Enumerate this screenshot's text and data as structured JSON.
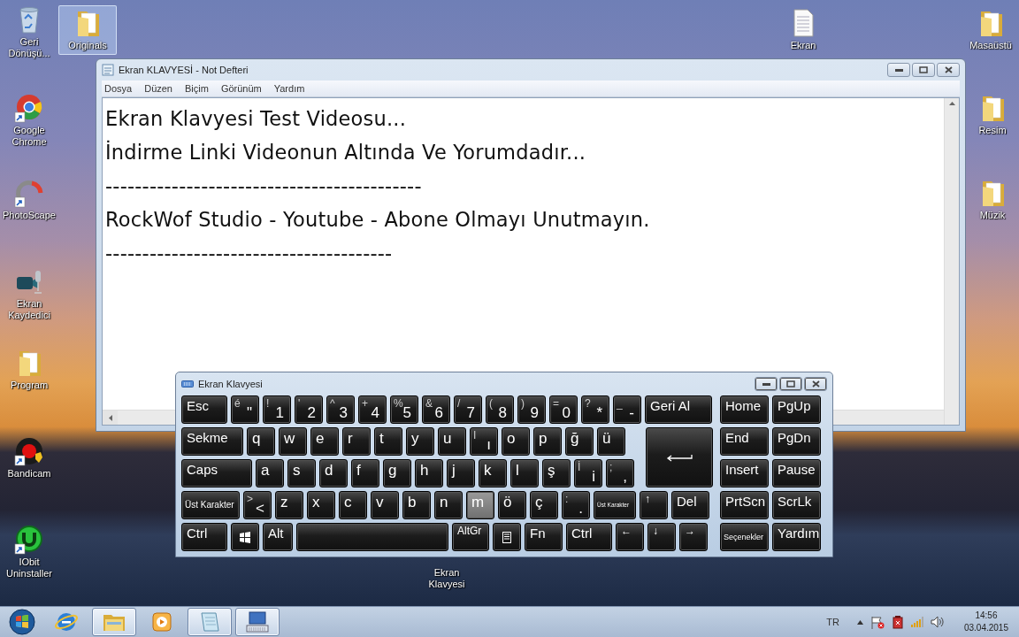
{
  "desktop": {
    "icons": [
      {
        "label": "Geri Dönüşü...",
        "kind": "bin",
        "selected": false
      },
      {
        "label": "Originals",
        "kind": "folder",
        "selected": true
      },
      {
        "label": "Google Chrome",
        "kind": "chrome",
        "selected": false
      },
      {
        "label": "PhotoScape",
        "kind": "gauge",
        "selected": false
      },
      {
        "label": "Ekran Kaydedici",
        "kind": "recorder",
        "selected": false
      },
      {
        "label": "Program",
        "kind": "folder",
        "selected": false
      },
      {
        "label": "Bandicam",
        "kind": "reddot",
        "selected": false
      },
      {
        "label": "IObit Uninstaller",
        "kind": "greenring",
        "selected": false
      },
      {
        "label": "Ekran",
        "kind": "textfile",
        "selected": false
      },
      {
        "label": "Masaüstü",
        "kind": "folder",
        "selected": false
      },
      {
        "label": "Resim",
        "kind": "folder",
        "selected": false
      },
      {
        "label": "Müzik",
        "kind": "folder",
        "selected": false
      },
      {
        "label": "Ekran Klavyesi",
        "kind": "covered",
        "selected": false
      }
    ]
  },
  "notepad": {
    "title": "Ekran KLAVYESİ - Not Defteri",
    "menu": [
      "Dosya",
      "Düzen",
      "Biçim",
      "Görünüm",
      "Yardım"
    ],
    "lines": [
      "Ekran Klavyesi Test Videosu...",
      "İndirme Linki Videonun Altında Ve Yorumdadır...",
      "-------------------------------------------",
      "RockWof Studio - Youtube - Abone Olmayı Unutmayın.",
      "---------------------------------------"
    ]
  },
  "keyboard": {
    "title": "Ekran Klavyesi",
    "rows": [
      {
        "keys": [
          {
            "label": "Esc",
            "kind": "esc",
            "lit": false
          },
          {
            "shift_label": "é",
            "label": "\"",
            "kind": "char",
            "lit": false
          },
          {
            "shift_label": "!",
            "label": "1",
            "kind": "char",
            "lit": false
          },
          {
            "shift_label": "'",
            "label": "2",
            "kind": "char",
            "lit": false
          },
          {
            "shift_label": "^",
            "label": "3",
            "kind": "char",
            "lit": false
          },
          {
            "shift_label": "+",
            "label": "4",
            "kind": "char",
            "lit": false
          },
          {
            "shift_label": "%",
            "label": "5",
            "kind": "char",
            "lit": false
          },
          {
            "shift_label": "&",
            "label": "6",
            "kind": "char",
            "lit": false
          },
          {
            "shift_label": "/",
            "label": "7",
            "kind": "char",
            "lit": false
          },
          {
            "shift_label": "(",
            "label": "8",
            "kind": "char",
            "lit": false
          },
          {
            "shift_label": ")",
            "label": "9",
            "kind": "char",
            "lit": false
          },
          {
            "shift_label": "=",
            "label": "0",
            "kind": "char",
            "lit": false
          },
          {
            "shift_label": "?",
            "label": "*",
            "kind": "char",
            "lit": false
          },
          {
            "shift_label": "_",
            "label": "-",
            "kind": "char",
            "lit": false
          },
          {
            "label": "Geri Al",
            "kind": "back",
            "lit": false
          }
        ]
      },
      {
        "keys": [
          {
            "label": "Sekme",
            "kind": "tab",
            "lit": false
          },
          {
            "label": "q",
            "kind": "char",
            "lit": false
          },
          {
            "label": "w",
            "kind": "char",
            "lit": false
          },
          {
            "label": "e",
            "kind": "char",
            "lit": false
          },
          {
            "label": "r",
            "kind": "char",
            "lit": false
          },
          {
            "label": "t",
            "kind": "char",
            "lit": false
          },
          {
            "label": "y",
            "kind": "char",
            "lit": false
          },
          {
            "label": "u",
            "kind": "char",
            "lit": false
          },
          {
            "shift_label": "I",
            "label": "ı",
            "kind": "char",
            "lit": false
          },
          {
            "label": "o",
            "kind": "char",
            "lit": false
          },
          {
            "label": "p",
            "kind": "char",
            "lit": false
          },
          {
            "label": "ğ",
            "kind": "char",
            "lit": false
          },
          {
            "label": "ü",
            "kind": "char",
            "lit": false
          },
          {
            "kind": "enter",
            "lit": false
          }
        ]
      },
      {
        "keys": [
          {
            "label": "Caps",
            "kind": "caps",
            "lit": false
          },
          {
            "label": "a",
            "kind": "char",
            "lit": false
          },
          {
            "label": "s",
            "kind": "char",
            "lit": false
          },
          {
            "label": "d",
            "kind": "char",
            "lit": false
          },
          {
            "label": "f",
            "kind": "char",
            "lit": false
          },
          {
            "label": "g",
            "kind": "char",
            "lit": false
          },
          {
            "label": "h",
            "kind": "char",
            "lit": false
          },
          {
            "label": "j",
            "kind": "char",
            "lit": false
          },
          {
            "label": "k",
            "kind": "char",
            "lit": false
          },
          {
            "label": "l",
            "kind": "char",
            "lit": false
          },
          {
            "label": "ş",
            "kind": "char",
            "lit": false
          },
          {
            "shift_label": "İ",
            "label": "i",
            "kind": "char",
            "lit": false
          },
          {
            "shift_label": ";",
            "label": ",",
            "kind": "char",
            "lit": false
          }
        ]
      },
      {
        "keys": [
          {
            "label": "Üst Karakter",
            "kind": "lshift",
            "lit": false
          },
          {
            "shift_label": ">",
            "label": "<",
            "kind": "char",
            "lit": false
          },
          {
            "label": "z",
            "kind": "char",
            "lit": false
          },
          {
            "label": "x",
            "kind": "char",
            "lit": false
          },
          {
            "label": "c",
            "kind": "char",
            "lit": false
          },
          {
            "label": "v",
            "kind": "char",
            "lit": false
          },
          {
            "label": "b",
            "kind": "char",
            "lit": false
          },
          {
            "label": "n",
            "kind": "char",
            "lit": false
          },
          {
            "label": "m",
            "kind": "char",
            "lit": true
          },
          {
            "label": "ö",
            "kind": "char",
            "lit": false
          },
          {
            "label": "ç",
            "kind": "char",
            "lit": false
          },
          {
            "shift_label": ":",
            "label": ".",
            "kind": "char",
            "lit": false
          },
          {
            "label": "Üst Karakter",
            "kind": "rshift",
            "lit": false
          },
          {
            "label": "↑",
            "kind": "arrow",
            "lit": false
          },
          {
            "label": "Del",
            "kind": "del",
            "lit": false
          }
        ]
      },
      {
        "keys": [
          {
            "label": "Ctrl",
            "kind": "esc",
            "lit": false
          },
          {
            "kind": "win",
            "lit": false
          },
          {
            "label": "Alt",
            "kind": "alt",
            "lit": false
          },
          {
            "kind": "space",
            "lit": false
          },
          {
            "label": "AltGr",
            "kind": "altgr",
            "lit": false
          },
          {
            "kind": "menu",
            "lit": false
          },
          {
            "label": "Fn",
            "kind": "fn",
            "lit": false
          },
          {
            "label": "Ctrl",
            "kind": "esc",
            "lit": false
          },
          {
            "label": "←",
            "kind": "arrow",
            "lit": false
          },
          {
            "label": "↓",
            "kind": "arrow",
            "lit": false
          },
          {
            "label": "→",
            "kind": "arrow",
            "lit": false
          }
        ]
      }
    ],
    "side_rows": [
      {
        "keys": [
          {
            "label": "Home",
            "kind": "side",
            "lit": false
          },
          {
            "label": "PgUp",
            "kind": "side",
            "lit": false
          }
        ]
      },
      {
        "keys": [
          {
            "label": "End",
            "kind": "side",
            "lit": false
          },
          {
            "label": "PgDn",
            "kind": "side",
            "lit": false
          }
        ]
      },
      {
        "keys": [
          {
            "label": "Insert",
            "kind": "side",
            "lit": false
          },
          {
            "label": "Pause",
            "kind": "side",
            "lit": false
          }
        ]
      },
      {
        "keys": [
          {
            "label": "PrtScn",
            "kind": "side",
            "lit": false
          },
          {
            "label": "ScrLk",
            "kind": "side",
            "lit": false
          }
        ]
      },
      {
        "keys": [
          {
            "label": "Seçenekler",
            "kind": "opts",
            "lit": false
          },
          {
            "label": "Yardım",
            "kind": "side",
            "lit": false
          }
        ]
      }
    ]
  },
  "taskbar": {
    "buttons": [
      {
        "kind": "start",
        "active": false
      },
      {
        "kind": "browser",
        "active": false
      },
      {
        "kind": "explorer",
        "active": true
      },
      {
        "kind": "media",
        "active": false
      },
      {
        "kind": "notepad",
        "active": true
      },
      {
        "kind": "keyboard",
        "active": true
      }
    ],
    "language": "TR",
    "time": "14:56",
    "date": "03.04.2015"
  }
}
